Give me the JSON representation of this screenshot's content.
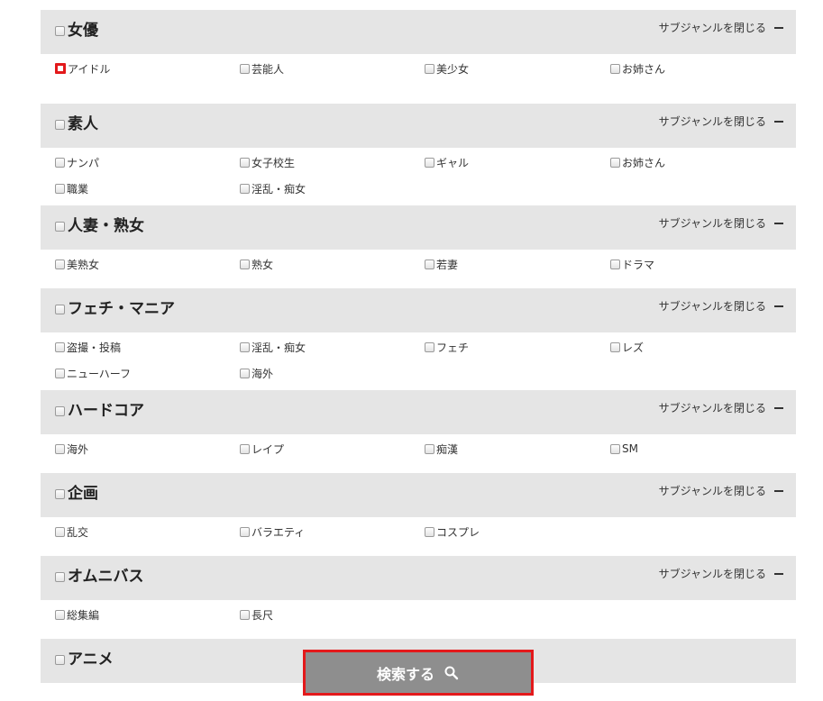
{
  "close_label": "サブジャンルを閉じる",
  "categories": [
    {
      "name": "女優",
      "collapsible": true,
      "subs": [
        "アイドル",
        "芸能人",
        "美少女",
        "お姉さん"
      ]
    },
    {
      "name": "素人",
      "collapsible": true,
      "subs": [
        "ナンパ",
        "女子校生",
        "ギャル",
        "お姉さん",
        "職業",
        "淫乱・痴女"
      ]
    },
    {
      "name": "人妻・熟女",
      "collapsible": true,
      "subs": [
        "美熟女",
        "熟女",
        "若妻",
        "ドラマ"
      ]
    },
    {
      "name": "フェチ・マニア",
      "collapsible": true,
      "subs": [
        "盗撮・投稿",
        "淫乱・痴女",
        "フェチ",
        "レズ",
        "ニューハーフ",
        "海外"
      ]
    },
    {
      "name": "ハードコア",
      "collapsible": true,
      "subs": [
        "海外",
        "レイプ",
        "痴漢",
        "SM"
      ]
    },
    {
      "name": "企画",
      "collapsible": true,
      "subs": [
        "乱交",
        "バラエティ",
        "コスプレ"
      ]
    },
    {
      "name": "オムニバス",
      "collapsible": true,
      "subs": [
        "総集編",
        "長尺"
      ]
    },
    {
      "name": "アニメ",
      "collapsible": false,
      "subs": []
    }
  ],
  "search_button": {
    "label": "検索する",
    "icon": "magnifier-icon"
  },
  "colors": {
    "header_bg": "#e5e5e5",
    "highlight": "#e3191b",
    "button_bg": "#8e8e8e"
  }
}
